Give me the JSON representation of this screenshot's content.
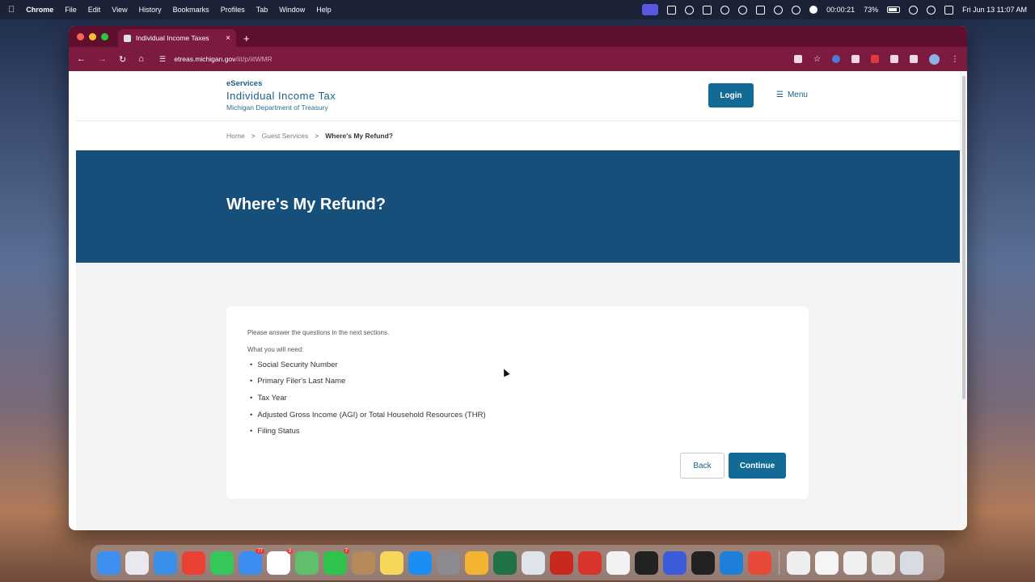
{
  "menubar": {
    "app": "Chrome",
    "items": [
      "File",
      "Edit",
      "View",
      "History",
      "Bookmarks",
      "Profiles",
      "Tab",
      "Window",
      "Help"
    ],
    "timer": "00:00:21",
    "battery": "73%",
    "datetime": "Fri Jun 13  11:07 AM"
  },
  "browser": {
    "tab_title": "Individual Income Taxes",
    "url_host": "etreas.michigan.gov",
    "url_path": "/iit/p/iitWMR",
    "new_tab": "+",
    "close_tab": "×"
  },
  "header": {
    "eservices": "eServices",
    "title": "Individual Income Tax",
    "dept": "Michigan Department of Treasury",
    "login": "Login",
    "menu": "Menu"
  },
  "breadcrumb": {
    "home": "Home",
    "guest": "Guest Services",
    "current": "Where's My Refund?",
    "sep": ">"
  },
  "hero": {
    "title": "Where's My Refund?"
  },
  "card": {
    "intro": "Please answer the questions in the next sections.",
    "need_label": "What you will need:",
    "items": [
      "Social Security Number",
      "Primary Filer's Last Name",
      "Tax Year",
      "Adjusted Gross Income (AGI) or Total Household Resources (THR)",
      "Filing Status"
    ],
    "back": "Back",
    "continue": "Continue"
  },
  "dock": {
    "apps": [
      {
        "name": "finder",
        "color": "#3d8ff0"
      },
      {
        "name": "launchpad",
        "color": "#e8e8ee"
      },
      {
        "name": "safari",
        "color": "#3a8fe8"
      },
      {
        "name": "chrome",
        "color": "#e94235"
      },
      {
        "name": "messages",
        "color": "#35c759"
      },
      {
        "name": "mail",
        "color": "#3b8ef0",
        "badge": "77"
      },
      {
        "name": "calendar",
        "color": "#ffffff",
        "badge": "3"
      },
      {
        "name": "maps",
        "color": "#5fbf6a"
      },
      {
        "name": "facetime",
        "color": "#2fc24d",
        "badge": "7"
      },
      {
        "name": "contacts",
        "color": "#b58a5a"
      },
      {
        "name": "notes",
        "color": "#f7d75a"
      },
      {
        "name": "app-store",
        "color": "#1b8ef5"
      },
      {
        "name": "system-settings",
        "color": "#8a8a90"
      },
      {
        "name": "files",
        "color": "#f2b431"
      },
      {
        "name": "excel",
        "color": "#1f7244"
      },
      {
        "name": "utility",
        "color": "#dfe3ea"
      },
      {
        "name": "acrobat",
        "color": "#c8281e"
      },
      {
        "name": "remote-desktop",
        "color": "#d9342b"
      },
      {
        "name": "chatgpt",
        "color": "#f2f2f2"
      },
      {
        "name": "zoom-camera",
        "color": "#222222"
      },
      {
        "name": "arc",
        "color": "#3b5bdb"
      },
      {
        "name": "sonos",
        "color": "#222222"
      },
      {
        "name": "windows-app",
        "color": "#1e7fd8"
      },
      {
        "name": "pdf-reader",
        "color": "#e84a3a"
      },
      {
        "name": "file-thumb-1",
        "color": "#eeeeee"
      },
      {
        "name": "file-thumb-2",
        "color": "#f5f5f5"
      },
      {
        "name": "file-thumb-3",
        "color": "#f0f0f0"
      },
      {
        "name": "file-thumb-4",
        "color": "#e8e8e8"
      },
      {
        "name": "trash",
        "color": "#d8dce2"
      }
    ]
  },
  "colors": {
    "brand_blue": "#16507a",
    "button_blue": "#146a97",
    "chrome_maroon": "#7c1a40"
  }
}
